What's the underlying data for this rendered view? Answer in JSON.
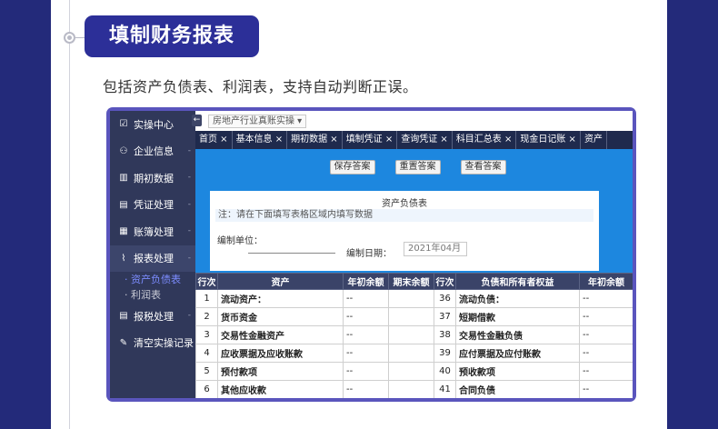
{
  "section": {
    "title": "填制财务报表",
    "description": "包括资产负债表、利润表，支持自动判断正误。"
  },
  "sidebar": {
    "items": [
      {
        "label": "实操中心",
        "icon": "☑",
        "arrow": ""
      },
      {
        "label": "企业信息",
        "icon": "⚇",
        "arrow": "-"
      },
      {
        "label": "期初数据",
        "icon": "▥",
        "arrow": "-"
      },
      {
        "label": "凭证处理",
        "icon": "▤",
        "arrow": "-"
      },
      {
        "label": "账簿处理",
        "icon": "▦",
        "arrow": "-"
      },
      {
        "label": "报表处理",
        "icon": "⌇",
        "arrow": "-"
      }
    ],
    "subitems": [
      {
        "label": "资产负债表"
      },
      {
        "label": "利润表"
      }
    ],
    "bottom_items": [
      {
        "label": "报税处理",
        "icon": "▤",
        "arrow": "-"
      },
      {
        "label": "清空实操记录",
        "icon": "✎",
        "arrow": ""
      }
    ]
  },
  "topbar": {
    "collapse": "←",
    "breadcrumb": "房地产行业真账实操 ▾"
  },
  "tabs": [
    {
      "label": "首页 ×"
    },
    {
      "label": "基本信息 ×"
    },
    {
      "label": "期初数据 ×"
    },
    {
      "label": "填制凭证 ×"
    },
    {
      "label": "查询凭证 ×"
    },
    {
      "label": "科目汇总表 ×"
    },
    {
      "label": "现金日记账 ×"
    },
    {
      "label": "资产"
    }
  ],
  "buttons": {
    "save": "保存答案",
    "reset": "重置答案",
    "view": "查看答案"
  },
  "sheet": {
    "title": "资产负债表",
    "note": "注：请在下面填写表格区域内填写数据",
    "unit_label": "编制单位：",
    "date_label": "编制日期：",
    "date_value": "2021年04月"
  },
  "table": {
    "headers": [
      "行次",
      "资产",
      "年初余额",
      "期末余额",
      "行次",
      "负债和所有者权益",
      "年初余额"
    ],
    "rows": [
      {
        "n1": "1",
        "a": "流动资产：",
        "v1": "--",
        "v2": "",
        "n2": "36",
        "b": "流动负债：",
        "v3": "--"
      },
      {
        "n1": "2",
        "a": "货币资金",
        "v1": "--",
        "v2": "",
        "n2": "37",
        "b": "短期借款",
        "v3": "--"
      },
      {
        "n1": "3",
        "a": "交易性金融资产",
        "v1": "--",
        "v2": "",
        "n2": "38",
        "b": "交易性金融负债",
        "v3": "--"
      },
      {
        "n1": "4",
        "a": "应收票据及应收账款",
        "v1": "--",
        "v2": "",
        "n2": "39",
        "b": "应付票据及应付账款",
        "v3": "--"
      },
      {
        "n1": "5",
        "a": "预付款项",
        "v1": "--",
        "v2": "",
        "n2": "40",
        "b": "预收款项",
        "v3": "--"
      },
      {
        "n1": "6",
        "a": "其他应收款",
        "v1": "--",
        "v2": "",
        "n2": "41",
        "b": "合同负债",
        "v3": "--"
      }
    ]
  }
}
